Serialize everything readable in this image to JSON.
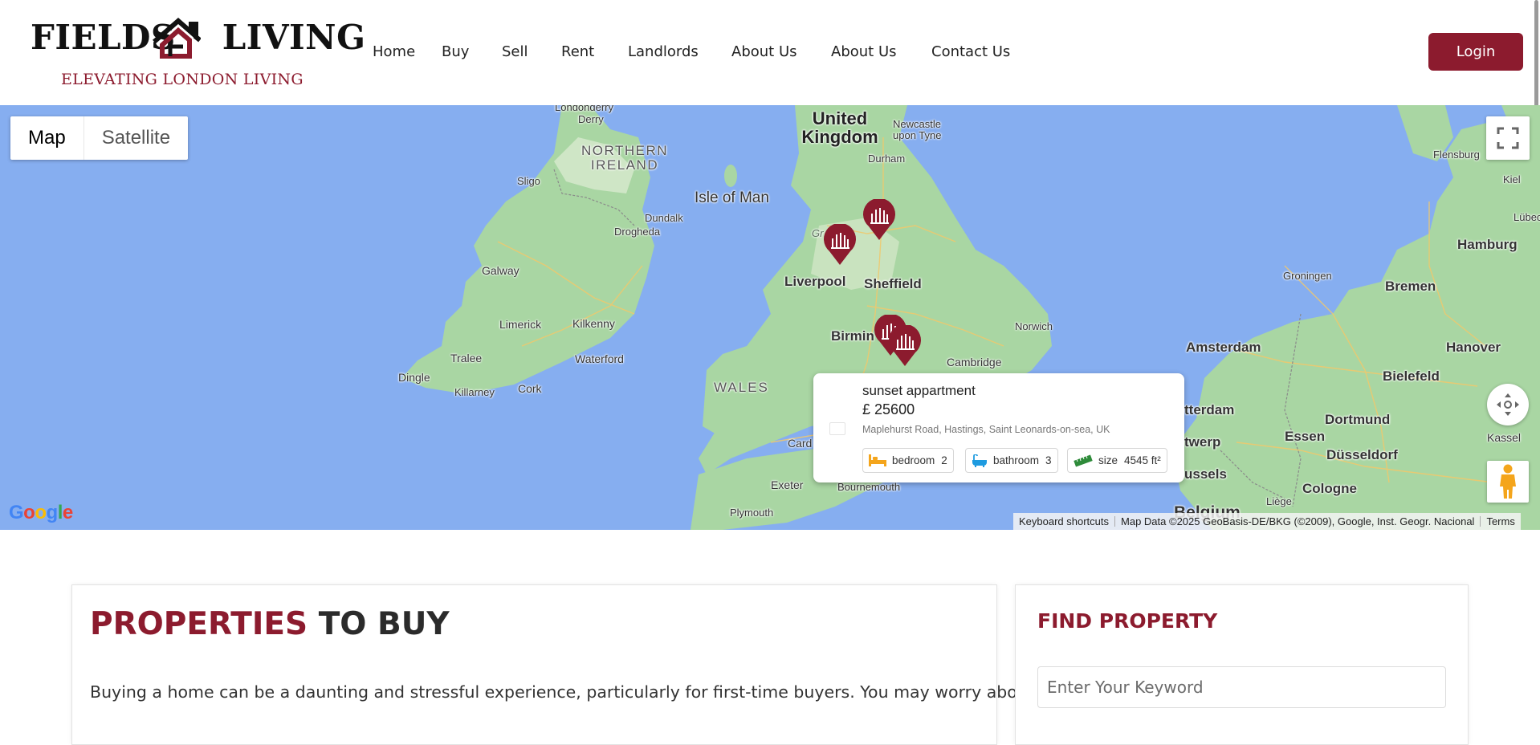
{
  "brand": {
    "name_left": "FIELDS",
    "name_right": "LIVING",
    "tagline": "ELEVATING LONDON LIVING",
    "accent_color": "#8c1b2e"
  },
  "nav": {
    "items": [
      "Home",
      "Buy",
      "Sell",
      "Rent",
      "Landlords",
      "About Us",
      "About Us",
      "Contact Us"
    ],
    "login_label": "Login"
  },
  "map": {
    "type_control": {
      "map_label": "Map",
      "satellite_label": "Satellite",
      "selected": "Map"
    },
    "labels": {
      "united_kingdom": "United Kingdom",
      "northern_ireland": "NORTHERN IRELAND",
      "isle_of_man": "Isle of Man",
      "wales": "WALES",
      "londonderry": "Londonderry",
      "derry": "Derry",
      "sligo": "Sligo",
      "dundalk": "Dundalk",
      "drogheda": "Drogheda",
      "galway": "Galway",
      "limerick": "Limerick",
      "kilkenny": "Kilkenny",
      "tralee": "Tralee",
      "waterford": "Waterford",
      "dingle": "Dingle",
      "killarney": "Killarney",
      "cork": "Cork",
      "newcastle": "Newcastle upon Tyne",
      "durham": "Durham",
      "liverpool": "Liverpool",
      "sheffield": "Sheffield",
      "birmingham": "Birmin",
      "norwich": "Norwich",
      "cambridge": "Cambridge",
      "cardiff": "Card",
      "exeter": "Exeter",
      "bournemouth": "Bournemouth",
      "plymouth": "Plymouth",
      "flensburg": "Flensburg",
      "kiel": "Kiel",
      "lubeck": "Lübec",
      "hamburg": "Hamburg",
      "groningen": "Groningen",
      "bremen": "Bremen",
      "amsterdam": "Amsterdam",
      "hanover": "Hanover",
      "bielefeld": "Bielefeld",
      "rotterdam": "tterdam",
      "dortmund": "Dortmund",
      "essen": "Essen",
      "kassel": "Kassel",
      "antwerp": "twerp",
      "dusseldorf": "Düsseldorf",
      "brussels": "ussels",
      "cologne": "Cologne",
      "liege": "Liège",
      "belgium": "Belgium",
      "greater_man": "Gr"
    },
    "pins_count": 4,
    "info_window": {
      "title": "sunset appartment",
      "currency": "£",
      "price": "25600",
      "address": "Maplehurst Road, Hastings, Saint Leonards-on-sea, UK",
      "bedroom_label": "bedroom",
      "bedroom_value": "2",
      "bathroom_label": "bathroom",
      "bathroom_value": "3",
      "size_label": "size",
      "size_value": "4545 ft²"
    },
    "google_logo": "Google",
    "attribution": {
      "shortcuts": "Keyboard shortcuts",
      "data": "Map Data ©2025 GeoBasis-DE/BKG (©2009), Google, Inst. Geogr. Nacional",
      "terms": "Terms"
    },
    "icons": [
      "fullscreen-icon",
      "camera-control-icon",
      "pegman-icon",
      "property-pin-icon",
      "bed-icon",
      "bath-icon",
      "ruler-icon"
    ]
  },
  "properties": {
    "title_accent": "PROPERTIES",
    "title_rest": "TO BUY",
    "description": "Buying a home can be a daunting and stressful experience, particularly for first-time buyers. You may worry about"
  },
  "find_property": {
    "title": "FIND PROPERTY",
    "keyword_placeholder": "Enter Your Keyword"
  }
}
